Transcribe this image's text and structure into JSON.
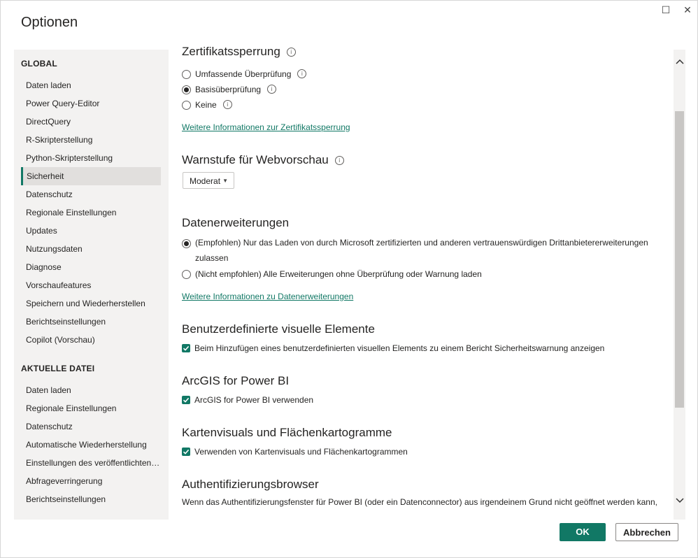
{
  "window": {
    "title": "Optionen",
    "maximize_icon": "☐",
    "close_icon": "✕"
  },
  "sidebar": {
    "global_heading": "GLOBAL",
    "global_items": [
      {
        "label": "Daten laden"
      },
      {
        "label": "Power Query-Editor"
      },
      {
        "label": "DirectQuery"
      },
      {
        "label": "R-Skripterstellung"
      },
      {
        "label": "Python-Skripterstellung"
      },
      {
        "label": "Sicherheit",
        "active": true
      },
      {
        "label": "Datenschutz"
      },
      {
        "label": "Regionale Einstellungen"
      },
      {
        "label": "Updates"
      },
      {
        "label": "Nutzungsdaten"
      },
      {
        "label": "Diagnose"
      },
      {
        "label": "Vorschaufeatures"
      },
      {
        "label": "Speichern und Wiederherstellen"
      },
      {
        "label": "Berichtseinstellungen"
      },
      {
        "label": "Copilot (Vorschau)"
      }
    ],
    "current_heading": "AKTUELLE DATEI",
    "current_items": [
      {
        "label": "Daten laden"
      },
      {
        "label": "Regionale Einstellungen"
      },
      {
        "label": "Datenschutz"
      },
      {
        "label": "Automatische Wiederherstellung"
      },
      {
        "label": "Einstellungen des veröffentlichten Berichts"
      },
      {
        "label": "Abfrageverringerung"
      },
      {
        "label": "Berichtseinstellungen"
      }
    ]
  },
  "content": {
    "cert_revocation": {
      "title": "Zertifikatssperrung",
      "options": [
        "Umfassende Überprüfung",
        "Basisüberprüfung",
        "Keine"
      ],
      "selected": "Basisüberprüfung",
      "link": "Weitere Informationen zur Zertifikatssperrung"
    },
    "web_preview": {
      "title": "Warnstufe für Webvorschau",
      "value": "Moderat"
    },
    "extensions": {
      "title": "Datenerweiterungen",
      "option1_line1": "(Empfohlen) Nur das Laden von durch Microsoft zertifizierten und anderen vertrauenswürdigen Drittanbietererweiterungen",
      "option1_line2": "zulassen",
      "option2": "(Nicht empfohlen) Alle Erweiterungen ohne Überprüfung oder Warnung laden",
      "selected": "option1",
      "link": "Weitere Informationen zu Datenerweiterungen"
    },
    "custom_visuals": {
      "title": "Benutzerdefinierte visuelle Elemente",
      "checkbox": "Beim Hinzufügen eines benutzerdefinierten visuellen Elements zu einem Bericht Sicherheitswarnung anzeigen",
      "checked": true
    },
    "arcgis": {
      "title": "ArcGIS for Power BI",
      "checkbox": "ArcGIS for Power BI verwenden",
      "checked": true
    },
    "maps": {
      "title": "Kartenvisuals und Flächenkartogramme",
      "checkbox": "Verwenden von Kartenvisuals und Flächenkartogrammen",
      "checked": true
    },
    "auth_browser": {
      "title": "Authentifizierungsbrowser",
      "text_line1": "Wenn das Authentifizierungsfenster für Power BI (oder ein Datenconnector) aus irgendeinem Grund nicht geöffnet werden kann,"
    }
  },
  "buttons": {
    "ok": "OK",
    "cancel": "Abbrechen"
  },
  "colors": {
    "accent": "#117865",
    "sidebar_bg": "#f3f2f1"
  }
}
